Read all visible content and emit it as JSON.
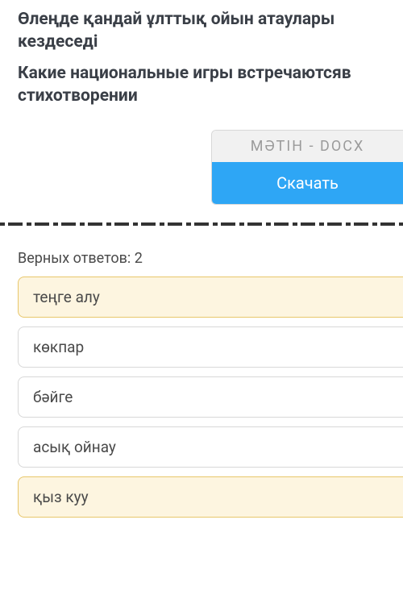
{
  "question": {
    "kz": "Өлеңде қандай ұлттық ойын атаулары кездеседі",
    "ru": "Какие национальные игры встречаютсяв стихотворении"
  },
  "file": {
    "label": "МӘТІН - DOCX",
    "download_label": "Скачать"
  },
  "answers": {
    "correct_count_label": "Верных ответов: 2",
    "options": [
      {
        "text": "теңге алу",
        "highlighted": true
      },
      {
        "text": "көкпар",
        "highlighted": false
      },
      {
        "text": "бәйге",
        "highlighted": false
      },
      {
        "text": "асық ойнау",
        "highlighted": false
      },
      {
        "text": "қыз куу",
        "highlighted": true
      }
    ]
  }
}
